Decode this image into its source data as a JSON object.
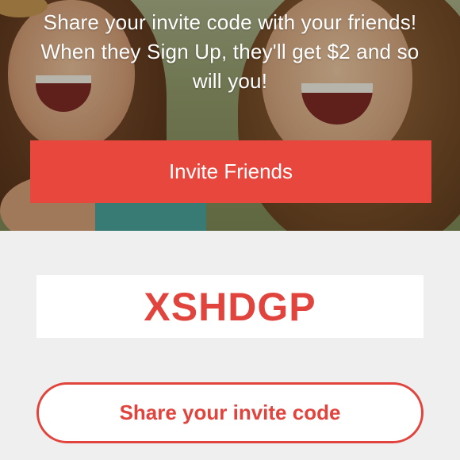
{
  "hero": {
    "message": "Share your invite code with your friends! When they Sign Up, they'll get $2 and so will you!",
    "invite_button_label": "Invite Friends",
    "image": "two-smiling-friends-photo"
  },
  "invite": {
    "code": "XSHDGP",
    "share_button_label": "Share your invite code"
  },
  "colors": {
    "accent": "#e8473e",
    "code_text": "#e1443d",
    "background": "#efefef",
    "surface": "#ffffff"
  }
}
